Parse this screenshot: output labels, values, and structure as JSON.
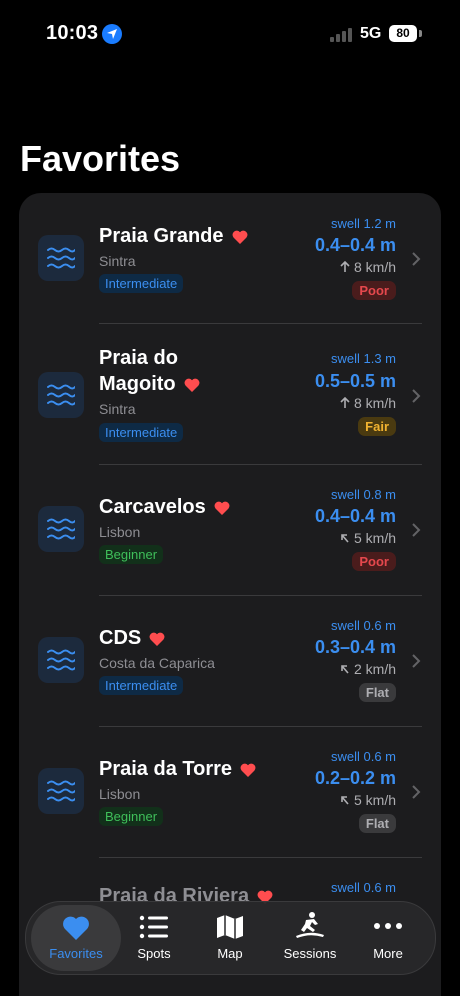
{
  "status": {
    "time": "10:03",
    "network": "5G",
    "battery": "80"
  },
  "page": {
    "title": "Favorites"
  },
  "spots": [
    {
      "name": "Praia Grande",
      "location": "Sintra",
      "level": "Intermediate",
      "swell": "swell 1.2 m",
      "height": "0.4–0.4 m",
      "wind": "8 km/h",
      "rating": "Poor"
    },
    {
      "name": "Praia do Magoito",
      "location": "Sintra",
      "level": "Intermediate",
      "swell": "swell 1.3 m",
      "height": "0.5–0.5 m",
      "wind": "8 km/h",
      "rating": "Fair"
    },
    {
      "name": "Carcavelos",
      "location": "Lisbon",
      "level": "Beginner",
      "swell": "swell 0.8 m",
      "height": "0.4–0.4 m",
      "wind": "5 km/h",
      "rating": "Poor"
    },
    {
      "name": "CDS",
      "location": "Costa da Caparica",
      "level": "Intermediate",
      "swell": "swell 0.6 m",
      "height": "0.3–0.4 m",
      "wind": "2 km/h",
      "rating": "Flat"
    },
    {
      "name": "Praia da Torre",
      "location": "Lisbon",
      "level": "Beginner",
      "swell": "swell 0.6 m",
      "height": "0.2–0.2 m",
      "wind": "5 km/h",
      "rating": "Flat"
    },
    {
      "name": "Praia da Riviera",
      "swell": "swell 0.6 m"
    }
  ],
  "tabs": [
    {
      "label": "Favorites",
      "icon": "heart-icon"
    },
    {
      "label": "Spots",
      "icon": "list-icon"
    },
    {
      "label": "Map",
      "icon": "map-icon"
    },
    {
      "label": "Sessions",
      "icon": "surfer-icon"
    },
    {
      "label": "More",
      "icon": "more-icon"
    }
  ],
  "colors": {
    "accent": "#3b8ef0",
    "heart": "#ff4d4f",
    "poor": "#e5484d",
    "fair": "#f0b230"
  }
}
